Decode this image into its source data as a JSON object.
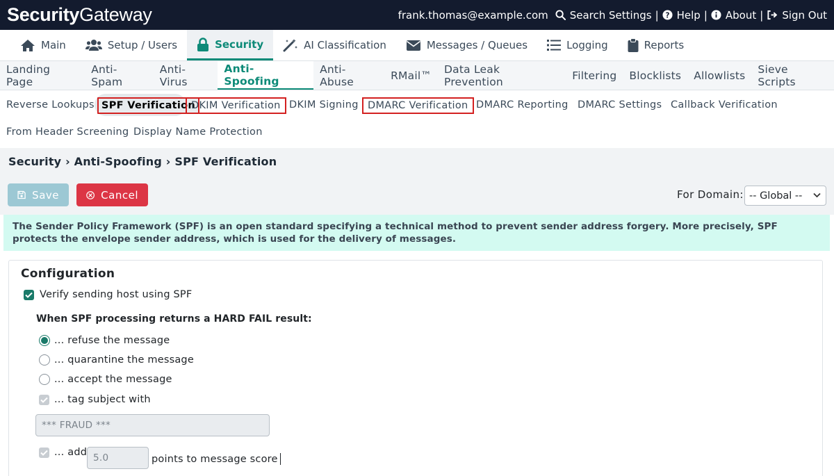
{
  "app": {
    "logo_bold": "Security",
    "logo_regular": "Gateway"
  },
  "topnav": {
    "email": "frank.thomas@example.com",
    "search": "Search Settings",
    "help": "Help",
    "about": "About",
    "signout": "Sign Out",
    "separator": "|"
  },
  "main_tabs": [
    {
      "label": "Main",
      "icon": "home-icon"
    },
    {
      "label": "Setup / Users",
      "icon": "users-icon"
    },
    {
      "label": "Security",
      "icon": "lock-icon",
      "active": true
    },
    {
      "label": "AI Classification",
      "icon": "magic-wand-icon"
    },
    {
      "label": "Messages / Queues",
      "icon": "envelope-icon"
    },
    {
      "label": "Logging",
      "icon": "list-icon"
    },
    {
      "label": "Reports",
      "icon": "clipboard-icon"
    }
  ],
  "sub_tabs": [
    "Landing Page",
    "Anti-Spam",
    "Anti-Virus",
    "Anti-Spoofing",
    "Anti-Abuse",
    "RMail™",
    "Data Leak Prevention",
    "Filtering",
    "Blocklists",
    "Allowlists",
    "Sieve Scripts"
  ],
  "third_nav": [
    "Reverse Lookups",
    "SPF Verification",
    "DKIM Verification",
    "DKIM Signing",
    "DMARC Verification",
    "DMARC Reporting",
    "DMARC Settings",
    "Callback Verification",
    "From Header Screening",
    "Display Name Protection"
  ],
  "breadcrumb": "Security › Anti-Spoofing › SPF Verification",
  "toolbar": {
    "save_label": "Save",
    "cancel_label": "Cancel",
    "domain_label": "For Domain:",
    "domain_value": "-- Global --"
  },
  "info_text": "The Sender Policy Framework (SPF) is an open standard specifying a technical method to prevent sender address forgery. More precisely, SPF protects the envelope sender address, which is used for the delivery of messages.",
  "config": {
    "title": "Configuration",
    "verify_label": "Verify sending host using SPF",
    "verify_checked": true,
    "hardfail_heading": "When SPF processing returns a HARD FAIL result:",
    "options": [
      {
        "label": "... refuse the message",
        "selected": true
      },
      {
        "label": "... quarantine the message",
        "selected": false
      },
      {
        "label": "... accept the message",
        "selected": false
      }
    ],
    "tag_label": "... tag subject with",
    "tag_value": "*** FRAUD ***",
    "add_label": "... add",
    "add_value": "5.0",
    "score_label": "points to message score"
  },
  "colors": {
    "header_bg": "#131b2e",
    "accent": "#0d8a78",
    "cancel": "#dc3545",
    "save_disabled": "#9cc8d4",
    "info_bg": "#d3faf1",
    "highlight_border": "#d32020"
  }
}
